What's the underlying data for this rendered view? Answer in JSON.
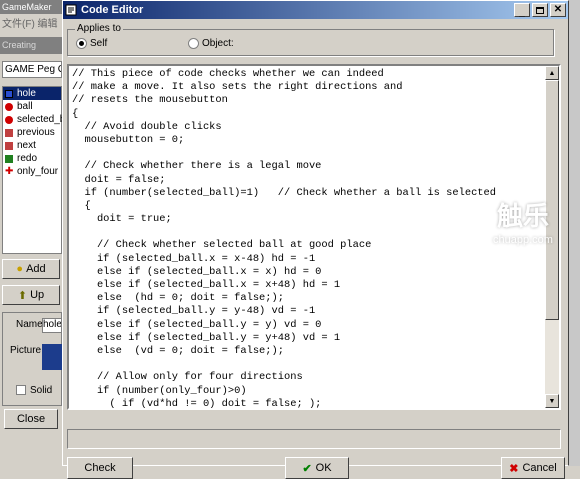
{
  "background": {
    "app_title": "GameMaker",
    "menu_text": "文件(F)  编辑",
    "creating_label": "Creating",
    "game_field": "GAME Peg G",
    "tree_items": [
      {
        "label": "hole",
        "icon": "square-blue-icon"
      },
      {
        "label": "ball",
        "icon": "red-ball-icon"
      },
      {
        "label": "selected_ball",
        "icon": "red-ball-icon"
      },
      {
        "label": "previous",
        "icon": "previous-icon"
      },
      {
        "label": "next",
        "icon": "next-icon"
      },
      {
        "label": "redo",
        "icon": "redo-icon"
      },
      {
        "label": "only_four",
        "icon": "red-cross-icon"
      }
    ],
    "add_label": "Add",
    "up_label": "Up",
    "name_label": "Name",
    "name_value": "hole",
    "picture_label": "Picture",
    "solid_label": "Solid",
    "close_label": "Close"
  },
  "window": {
    "title": "Code Editor",
    "applies_to": "Applies to",
    "self_label": "Self",
    "object_label": "Object:",
    "ok_label": "OK",
    "check_label": "Check",
    "cancel_label": "Cancel"
  },
  "code_lines": [
    "// This piece of code checks whether we can indeed",
    "// make a move. It also sets the right directions and",
    "// resets the mousebutton",
    "{",
    "  // Avoid double clicks",
    "  mousebutton = 0;",
    "",
    "  // Check whether there is a legal move",
    "  doit = false;",
    "  if (number(selected_ball)=1)   // Check whether a ball is selected",
    "  {",
    "    doit = true;",
    "",
    "    // Check whether selected ball at good place",
    "    if (selected_ball.x = x-48) hd = -1",
    "    else if (selected_ball.x = x) hd = 0",
    "    else if (selected_ball.x = x+48) hd = 1",
    "    else  (hd = 0; doit = false;);",
    "    if (selected_ball.y = y-48) vd = -1",
    "    else if (selected_ball.y = y) vd = 0",
    "    else if (selected_ball.y = y+48) vd = 1",
    "    else  (vd = 0; doit = false;);",
    "",
    "    // Allow only for four directions",
    "    if (number(only_four)>0)",
    "      ( if (vd*hd != 0) doit = false; );"
  ],
  "watermark": {
    "main": "触乐",
    "sub": "chuapp.com"
  }
}
